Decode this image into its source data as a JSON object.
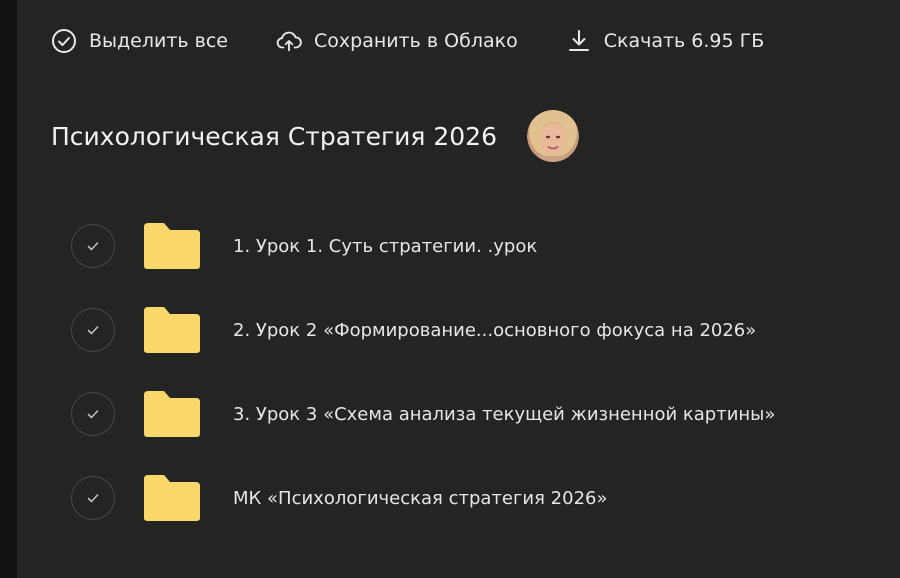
{
  "toolbar": {
    "select_all_label": "Выделить все",
    "save_cloud_label": "Сохранить в Облако",
    "download_label": "Скачать 6.95 ГБ"
  },
  "header": {
    "title": "Психологическая Стратегия 2026"
  },
  "items": [
    {
      "label": "1. Урок 1. Суть стратегии. .урок"
    },
    {
      "label": "2. Урок 2 «Формирование...основного фокуса на 2026»"
    },
    {
      "label": "3. Урок 3 «Схема анализа текущей жизненной картины»"
    },
    {
      "label": "МК «Психологическая стратегия 2026»"
    }
  ],
  "colors": {
    "background": "#242424",
    "folder": "#f9d76b",
    "text": "#e6e6e6"
  },
  "icons": {
    "select_all": "check-circle-icon",
    "save_cloud": "cloud-upload-icon",
    "download": "download-icon",
    "item_check": "check-icon",
    "item_folder": "folder-icon"
  }
}
